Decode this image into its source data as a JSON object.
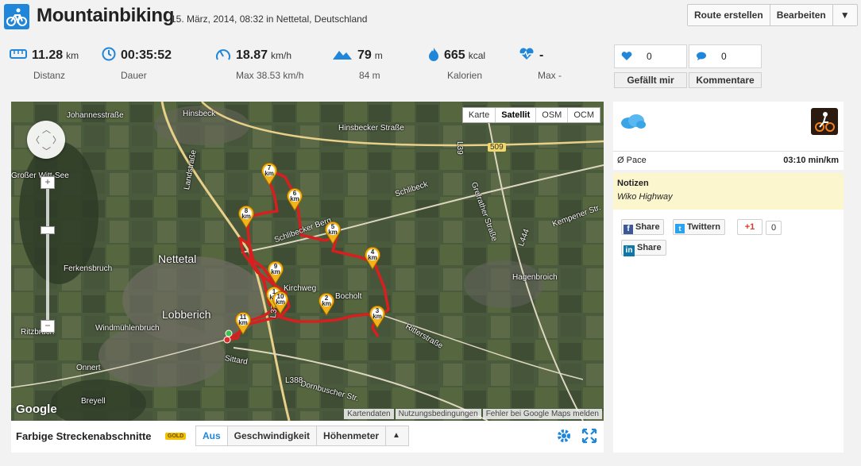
{
  "header": {
    "title": "Mountainbiking",
    "subtitle": "15. März, 2014, 08:32 in Nettetal, Deutschland",
    "buttons": [
      "Route erstellen",
      "Bearbeiten"
    ],
    "dropdown_icon": "▼",
    "logo_icon": "bike-icon"
  },
  "stats": [
    {
      "icon": "ruler-icon",
      "value": "11.28",
      "unit": "km",
      "label": "Distanz"
    },
    {
      "icon": "clock-icon",
      "value": "00:35:52",
      "unit": "",
      "label": "Dauer"
    },
    {
      "icon": "speed-icon",
      "value": "18.87",
      "unit": "km/h",
      "label": "Max 38.53 km/h"
    },
    {
      "icon": "mountain-icon",
      "value": "79",
      "unit": "m",
      "label": "84 m"
    },
    {
      "icon": "flame-icon",
      "value": "665",
      "unit": "kcal",
      "label": "Kalorien"
    },
    {
      "icon": "heartrate-icon",
      "value": "-",
      "unit": "",
      "label": "Max -"
    }
  ],
  "social": {
    "likes": "0",
    "comments": "0",
    "like_label": "Gefällt mir",
    "comment_label": "Kommentare"
  },
  "map": {
    "types": [
      "Karte",
      "Satellit",
      "OSM",
      "OCM"
    ],
    "active_type": "Satellit",
    "attribution": [
      "Kartendaten",
      "Nutzungsbedingungen",
      "Fehler bei Google Maps melden"
    ],
    "google_logo": "Google",
    "km_markers": [
      "1",
      "2",
      "3",
      "4",
      "5",
      "6",
      "7",
      "8",
      "9",
      "10",
      "11"
    ],
    "km_unit": "km",
    "places": [
      "Johannesstraße",
      "Hinsbeck",
      "Hinsbecker Straße",
      "Landstraße",
      "Schlibeck",
      "Grefrather Straße",
      "Nettetal",
      "Lobberich",
      "Kirchweg",
      "Bocholt",
      "Ritterstraße",
      "Hagenbroich",
      "Ferkensbruch",
      "Windmühlenbruch",
      "Ritzbruch",
      "Onnert",
      "Breyell",
      "Sittard",
      "Dornbuscher Str.",
      "Kempener Str.",
      "Großer Witt-See",
      "L39",
      "L444",
      "L373",
      "L388",
      "509",
      "Schlibecker Berg"
    ]
  },
  "footer": {
    "title": "Farbige Streckenabschnitte",
    "gold": "GOLD",
    "segments": [
      "Aus",
      "Geschwindigkeit",
      "Höhenmeter"
    ],
    "active_segment": "Aus"
  },
  "sidebar": {
    "weather_icon": "cloud-icon",
    "sport_icon": "mountainbike-icon",
    "pace_label": "Ø Pace",
    "pace_value": "03:10 min/km",
    "notes_title": "Notizen",
    "notes_text": "Wiko Highway",
    "share_facebook": "Share",
    "share_twitter": "Twittern",
    "gplus": "+1",
    "gplus_count": "0",
    "share_linkedin": "Share"
  }
}
